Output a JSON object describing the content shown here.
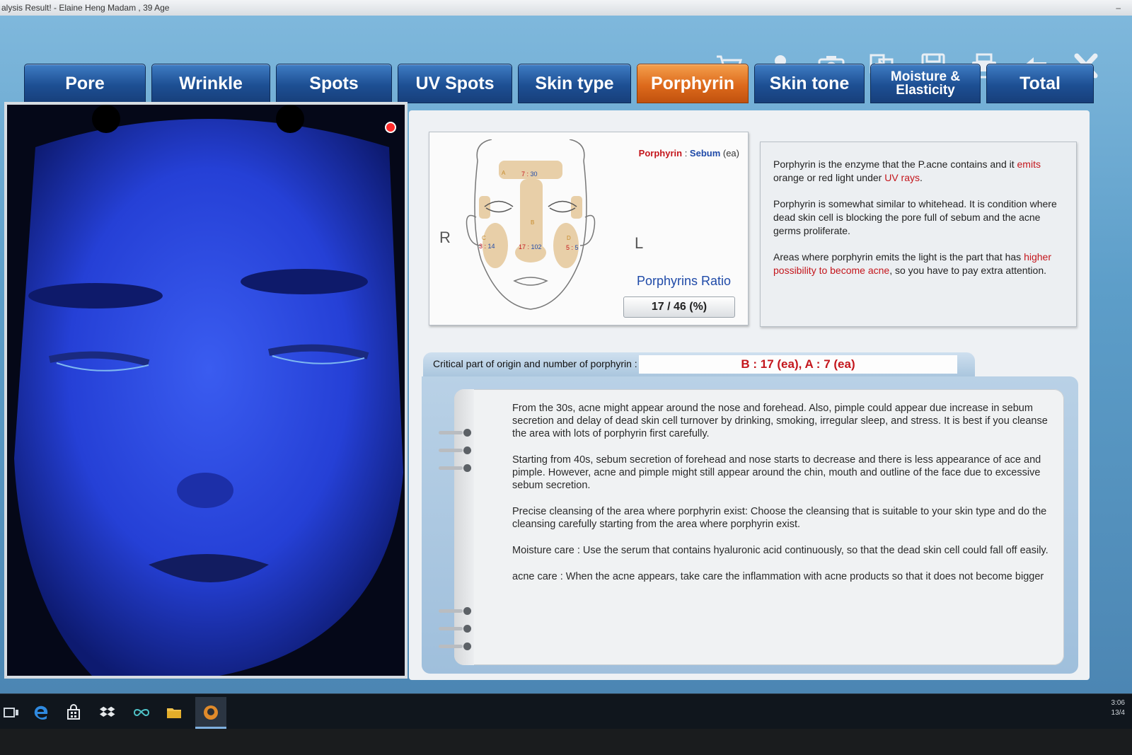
{
  "window": {
    "title": "alysis Result! - Elaine Heng Madam ,  39 Age",
    "minimize": "–"
  },
  "tabs": [
    {
      "label": "Pore",
      "active": false
    },
    {
      "label": "Wrinkle",
      "active": false
    },
    {
      "label": "Spots",
      "active": false
    },
    {
      "label": "UV Spots",
      "active": false
    },
    {
      "label": "Skin type",
      "active": false
    },
    {
      "label": "Porphyrin",
      "active": true
    },
    {
      "label": "Skin tone",
      "active": false
    },
    {
      "label": "Moisture & Elasticity",
      "active": false
    },
    {
      "label": "Total",
      "active": false
    }
  ],
  "toolbar": [
    "cart-icon",
    "user-icon",
    "camera-icon",
    "compare-icon",
    "save-icon",
    "print-icon",
    "back-arrow-icon",
    "close-icon"
  ],
  "diagram": {
    "legend_porphyrin": "Porphyrin",
    "legend_sep": " : ",
    "legend_sebum": "Sebum",
    "legend_unit": " (ea)",
    "side_right": "R",
    "side_left": "L",
    "ratio_label": "Porphyrins Ratio",
    "ratio_value": "17 / 46 (%)",
    "zones": [
      {
        "letter": "A",
        "porphyrin": "7",
        "sebum": "30"
      },
      {
        "letter": "B",
        "porphyrin": "17",
        "sebum": "102"
      },
      {
        "letter": "C",
        "porphyrin": "3",
        "sebum": "14"
      },
      {
        "letter": "D",
        "porphyrin": "5",
        "sebum": "5"
      }
    ]
  },
  "info": {
    "p1_a": "Porphyrin is the enzyme that the P.acne contains and it ",
    "p1_b": "emits",
    "p1_c": " orange or red light under ",
    "p1_d": "UV rays",
    "p1_e": ".",
    "p2": "Porphyrin is somewhat similar to whitehead. It is condition where dead skin cell is blocking the pore full of sebum and the acne germs proliferate.",
    "p3_a": "Areas where porphyrin emits the light is the part that has ",
    "p3_b": "higher possibility to become acne",
    "p3_c": ", so you have to pay extra attention."
  },
  "critical": {
    "label": "Critical part of origin and number of porphyrin :",
    "value": "B : 17 (ea), A : 7 (ea)"
  },
  "notes": [
    "From the 30s, acne might appear around the nose and forehead. Also, pimple could appear due increase in sebum secretion and delay of dead skin cell turnover by drinking, smoking, irregular sleep, and stress. It is best if you cleanse the area with lots of porphyrin first carefully.",
    "Starting from 40s, sebum secretion of forehead and nose starts to decrease and there is less appearance of ace and pimple. However, acne and pimple might still appear around the chin, mouth and outline of the face due to excessive sebum secretion.",
    "Precise cleansing of the area where porphyrin exist: Choose the cleansing that is suitable to your skin type and do the cleansing carefully starting from the area where porphyrin exist.",
    "Moisture care : Use the serum that contains hyaluronic acid continuously, so that the dead skin cell could fall off easily.",
    "acne care : When the acne appears, take care the inflammation with acne products so that it does not become bigger"
  ],
  "taskbar": {
    "icons": [
      "task-view-icon",
      "edge-icon",
      "store-icon",
      "dropbox-icon",
      "infinity-icon",
      "folder-icon",
      "skin-analyzer-app-icon"
    ],
    "time": "3:06",
    "date": "13/4"
  },
  "colors": {
    "accent_red": "#c4161c",
    "accent_blue": "#1f4aa8",
    "active_tab": "#dd6a1c",
    "tab": "#1d4f93"
  }
}
